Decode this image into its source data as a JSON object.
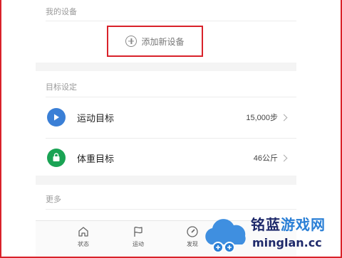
{
  "devices": {
    "section_title": "我的设备",
    "add_label": "添加新设备"
  },
  "goals": {
    "section_title": "目标设定",
    "items": [
      {
        "label": "运动目标",
        "value": "15,000步",
        "icon": "flag-icon",
        "color": "#3a7fd6"
      },
      {
        "label": "体重目标",
        "value": "46公斤",
        "icon": "weight-bag-icon",
        "color": "#1aa354"
      }
    ]
  },
  "more": {
    "section_title": "更多"
  },
  "tabbar": {
    "tabs": [
      {
        "label": "状态",
        "icon": "home-icon"
      },
      {
        "label": "运动",
        "icon": "flag-outline-icon"
      },
      {
        "label": "发现",
        "icon": "compass-icon"
      }
    ]
  },
  "watermark": {
    "cn_part1": "铭蓝",
    "cn_part2": "游戏网",
    "en": "minglan.cc"
  },
  "colors": {
    "highlight_border": "#d9222a",
    "flag_blue": "#3a7fd6",
    "bag_green": "#1aa354"
  }
}
